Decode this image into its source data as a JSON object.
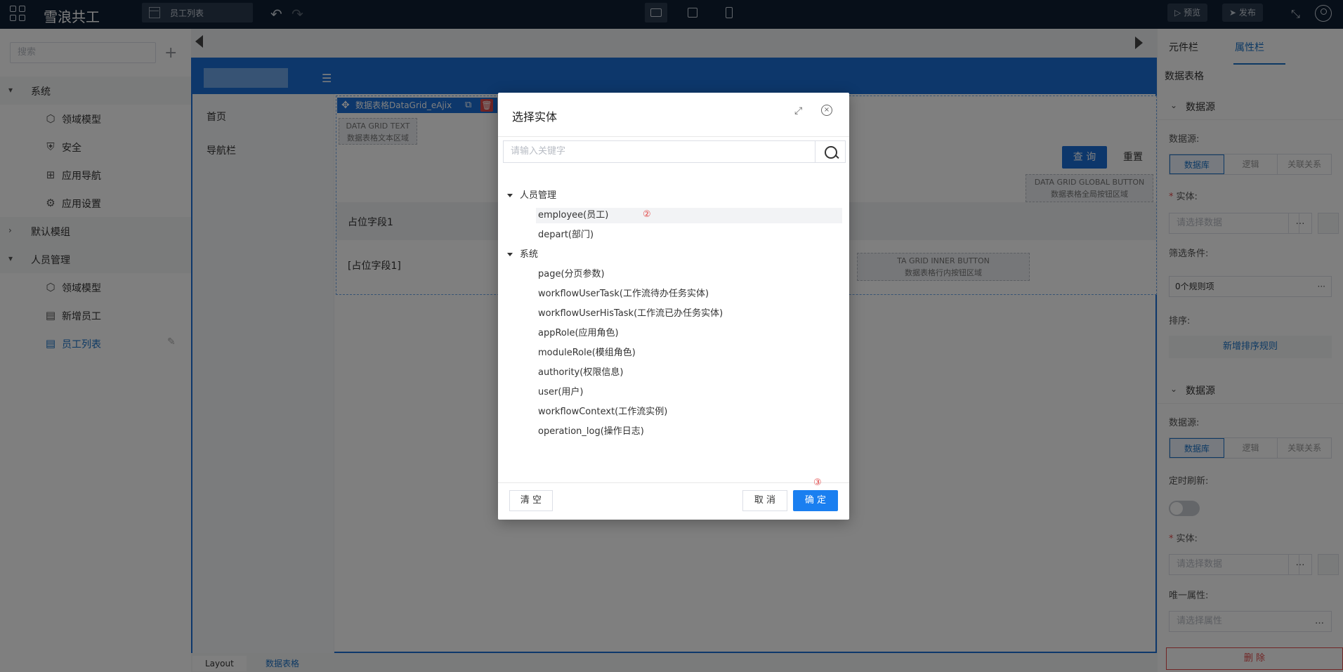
{
  "topbar": {
    "app_title": "雪浪共工",
    "page_tab": "员工列表",
    "preview_label": "预览",
    "publish_label": "发布"
  },
  "sidebar": {
    "search_placeholder": "搜索",
    "groups": [
      {
        "label": "系统",
        "items": [
          "领域模型",
          "安全",
          "应用导航",
          "应用设置"
        ]
      },
      {
        "label": "默认模组",
        "items": []
      },
      {
        "label": "人员管理",
        "items": [
          "领域模型",
          "新增员工",
          "员工列表"
        ]
      }
    ]
  },
  "canvas": {
    "nav_items": [
      "首页",
      "导航栏"
    ],
    "grid_tag": "数据表格DataGrid_eAjix",
    "text_area_en": "DATA GRID TEXT",
    "text_area_cn": "数据表格文本区域",
    "query_label": "查 询",
    "reset_label": "重置",
    "global_btn_en": "DATA GRID GLOBAL BUTTON",
    "global_btn_cn": "数据表格全局按钮区域",
    "header_field": "占位字段1",
    "body_field": "[占位字段1]",
    "inner_btn_en": "TA GRID INNER BUTTON",
    "inner_btn_cn": "数据表格行内按钮区域"
  },
  "breadcrumb": [
    "Layout",
    "数据表格"
  ],
  "right_panel": {
    "tabs": [
      "元件栏",
      "属性栏"
    ],
    "section_title": "数据表格",
    "ds1": {
      "title": "数据源",
      "source_label": "数据源:",
      "options": [
        "数据库",
        "逻辑",
        "关联关系"
      ],
      "entity_label": "实体:",
      "entity_placeholder": "请选择数据",
      "filter_label": "筛选条件:",
      "filter_value": "0个规则项",
      "sort_label": "排序:",
      "add_sort": "新增排序规则"
    },
    "ds2": {
      "title": "数据源",
      "source_label": "数据源:",
      "options": [
        "数据库",
        "逻辑",
        "关联关系"
      ],
      "refresh_label": "定时刷新:",
      "entity_label": "实体:",
      "entity_placeholder": "请选择数据",
      "unique_label": "唯一属性:",
      "unique_placeholder": "请选择属性"
    },
    "delete_label": "删 除"
  },
  "modal": {
    "title": "选择实体",
    "search_placeholder": "请输入关键字",
    "tree": [
      {
        "label": "人员管理",
        "children": [
          "employee(员工)",
          "depart(部门)"
        ]
      },
      {
        "label": "系统",
        "children": [
          "page(分页参数)",
          "workflowUserTask(工作流待办任务实体)",
          "workflowUserHisTask(工作流已办任务实体)",
          "appRole(应用角色)",
          "moduleRole(模组角色)",
          "authority(权限信息)",
          "user(用户)",
          "workflowContext(工作流实例)",
          "operation_log(操作日志)"
        ]
      }
    ],
    "markers": [
      "②",
      "③"
    ],
    "clear_label": "清 空",
    "cancel_label": "取 消",
    "ok_label": "确 定"
  },
  "colors": {
    "topbar": "#0f1f33",
    "accent": "#1a6fd6",
    "primary_button": "#1a7ff0",
    "danger": "#e24a4a"
  }
}
